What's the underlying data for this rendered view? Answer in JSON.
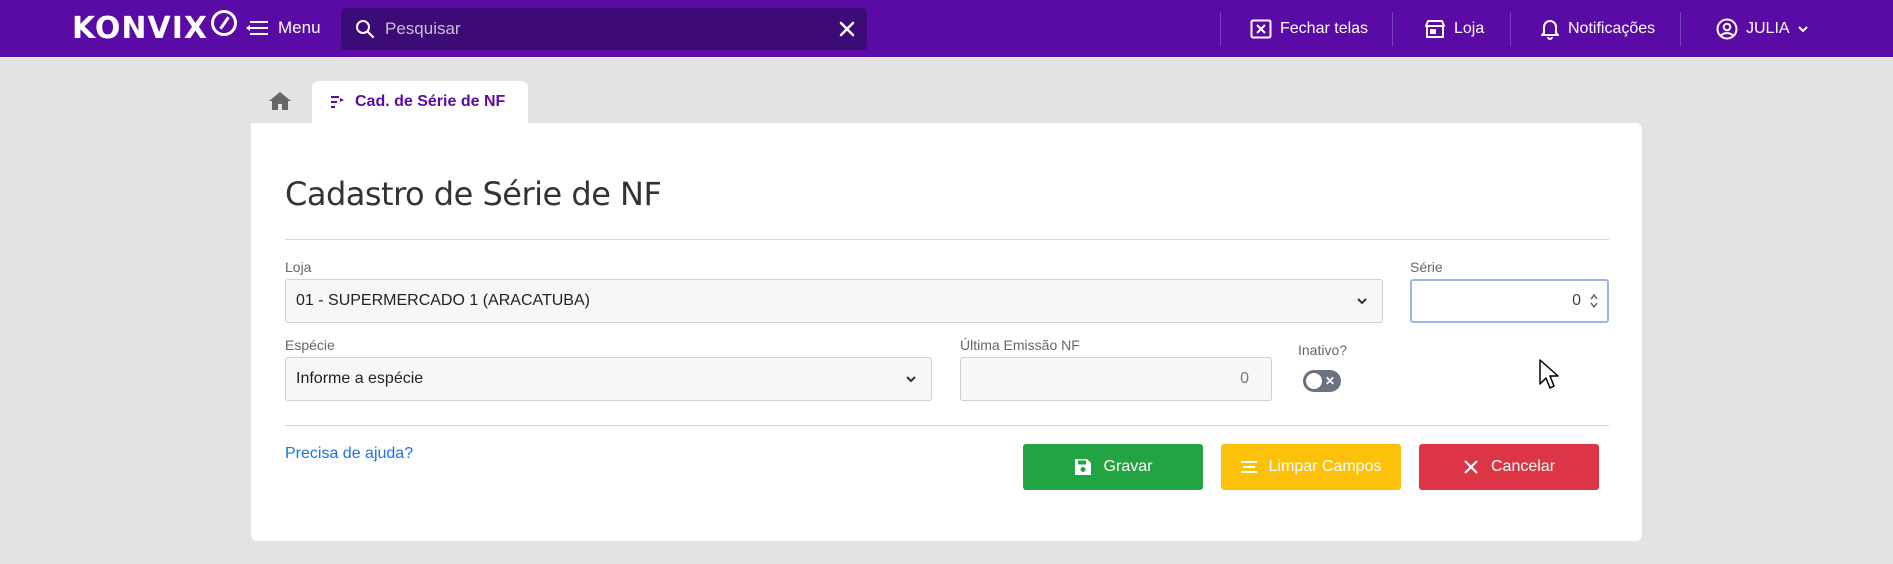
{
  "topbar": {
    "logo_text": "KONVIX",
    "menu_label": "Menu",
    "search_placeholder": "Pesquisar",
    "nav": {
      "close_screens": "Fechar telas",
      "store": "Loja",
      "notifications": "Notificações",
      "user": "JULIA"
    },
    "color": "#5a0aa5"
  },
  "tabs": {
    "active_label": "Cad. de Série de NF"
  },
  "form": {
    "title": "Cadastro de Série de NF",
    "loja": {
      "label": "Loja",
      "value": "01 - SUPERMERCADO 1 (ARACATUBA)"
    },
    "serie": {
      "label": "Série",
      "value": "0"
    },
    "especie": {
      "label": "Espécie",
      "value": "Informe a espécie"
    },
    "ultima_emissao": {
      "label": "Última Emissão NF",
      "value": "0"
    },
    "inativo": {
      "label": "Inativo?",
      "checked": false
    },
    "help_link": "Precisa de ajuda?",
    "buttons": {
      "save": "Gravar",
      "clear": "Limpar Campos",
      "cancel": "Cancelar"
    }
  }
}
